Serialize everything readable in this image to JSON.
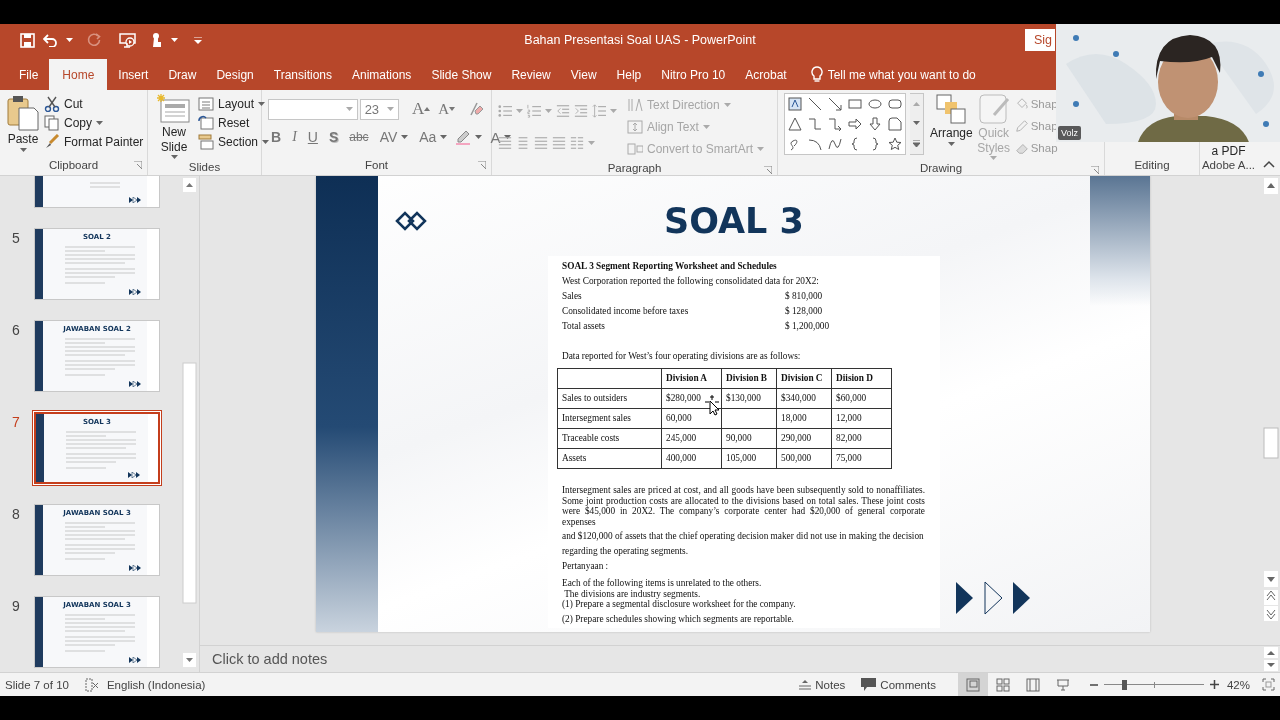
{
  "window": {
    "title": "Bahan Presentasi Soal UAS  -  PowerPoint",
    "sign_in": "Sig"
  },
  "tabs": [
    {
      "label": "File",
      "selected": false
    },
    {
      "label": "Home",
      "selected": true
    },
    {
      "label": "Insert",
      "selected": false
    },
    {
      "label": "Draw",
      "selected": false
    },
    {
      "label": "Design",
      "selected": false
    },
    {
      "label": "Transitions",
      "selected": false
    },
    {
      "label": "Animations",
      "selected": false
    },
    {
      "label": "Slide Show",
      "selected": false
    },
    {
      "label": "Review",
      "selected": false
    },
    {
      "label": "View",
      "selected": false
    },
    {
      "label": "Help",
      "selected": false
    },
    {
      "label": "Nitro Pro 10",
      "selected": false
    },
    {
      "label": "Acrobat",
      "selected": false
    }
  ],
  "tell_me": "Tell me what you want to do",
  "clipboard": {
    "title": "Clipboard",
    "paste": "Paste",
    "cut": "Cut",
    "copy": "Copy",
    "format_painter": "Format Painter"
  },
  "slides_group": {
    "title": "Slides",
    "new_slide": "New Slide",
    "layout": "Layout",
    "reset": "Reset",
    "section": "Section"
  },
  "font": {
    "title": "Font",
    "size": "23",
    "grow": "A",
    "shrink": "A",
    "format_buttons": [
      {
        "label": "B",
        "kind": "bold"
      },
      {
        "label": "I",
        "kind": "italic"
      },
      {
        "label": "U",
        "kind": "underline"
      },
      {
        "label": "S",
        "kind": "shadow"
      },
      {
        "label": "abc",
        "kind": "strike"
      },
      {
        "label": "AV",
        "kind": "spacing"
      },
      {
        "label": "Aa",
        "kind": "case"
      }
    ],
    "color_label": "A"
  },
  "paragraph": {
    "title": "Paragraph",
    "disabled": true,
    "text_direction": "Text Direction",
    "align_text": "Align Text",
    "convert": "Convert to SmartArt"
  },
  "drawing": {
    "title": "Drawing",
    "arrange": "Arrange",
    "quick_styles": {
      "label": "Quick Styles",
      "disabled": true
    },
    "shape_buttons": [
      "Shap",
      "Shap",
      "Shap"
    ]
  },
  "editing": {
    "title": "Editing"
  },
  "adobe": {
    "label": "a PDF",
    "title": "Adobe A..."
  },
  "thumbnails": [
    {
      "kind": "partial",
      "selected": false
    },
    {
      "kind": "full",
      "number": "5",
      "title": "SOAL 2",
      "selected": false
    },
    {
      "kind": "full",
      "number": "6",
      "title": "JAWABAN SOAL 2",
      "selected": false
    },
    {
      "kind": "full",
      "number": "7",
      "title": "SOAL 3",
      "selected": true
    },
    {
      "kind": "full",
      "number": "8",
      "title": "JAWABAN SOAL 3",
      "selected": false
    },
    {
      "kind": "full",
      "number": "9",
      "title": "JAWABAN SOAL 3",
      "selected": false
    }
  ],
  "slide": {
    "title": "SOAL 3",
    "heading": "SOAL 3 Segment Reporting Worksheet and Schedules",
    "intro": "West Corporation reported the following consolidated data for 20X2:",
    "summary": [
      {
        "label": "Sales",
        "value": "$ 810,000"
      },
      {
        "label": "Consolidated income before taxes",
        "value": "$ 128,000"
      },
      {
        "label": "Total assets",
        "value": "$ 1,200,000"
      }
    ],
    "table_intro": "Data reported for West’s four operating divisions are as follows:",
    "table": {
      "columns": [
        "Division A",
        "Division B",
        "Division C",
        "Diision D"
      ],
      "rows": [
        {
          "label": "Sales to outsiders",
          "cells": [
            "$280,000",
            "$130,000",
            "$340,000",
            "$60,000"
          ]
        },
        {
          "label": "Intersegment sales",
          "cells": [
            "60,000",
            null,
            "18,000",
            "12,000"
          ]
        },
        {
          "label": "Traceable costs",
          "cells": [
            "245,000",
            "90,000",
            "290,000",
            "82,000"
          ]
        },
        {
          "label": "Assets",
          "cells": [
            "400,000",
            "105,000",
            "500,000",
            "75,000"
          ]
        }
      ]
    },
    "paragraph": "Intersegment sales are priced at cost, and all goods have been subsequently sold to nonaffiliates. Some joint production costs are allocated to the divisions based on total sales. These joint costs were $45,000 in 20X2. The company’s corporate center had $20,000 of general corporate expenses",
    "lines": [
      "and $120,000 of assets that the chief operating decision maker did not use in making the decision",
      "regarding the operating segments.",
      "Pertanyaan :"
    ],
    "questions": [
      "Each of the following items is unrelated to the others.",
      " The divisions are industry segments.",
      "(1) Prepare a segmental disclosure worksheet for the company.",
      "(2) Prepare schedules showing which segments are reportable."
    ]
  },
  "notes_placeholder": "Click to add notes",
  "status": {
    "slide": "Slide 7 of 10",
    "language": "English (Indonesia)",
    "notes": "Notes",
    "comments": "Comments",
    "views": [
      {
        "kind": "normal",
        "selected": true
      },
      {
        "kind": "sorter",
        "selected": false
      },
      {
        "kind": "reading",
        "selected": false
      },
      {
        "kind": "slideshow",
        "selected": false
      }
    ],
    "zoom": {
      "level": 0.2,
      "reading": "42%"
    }
  },
  "webcam": {
    "name": "Volz"
  }
}
